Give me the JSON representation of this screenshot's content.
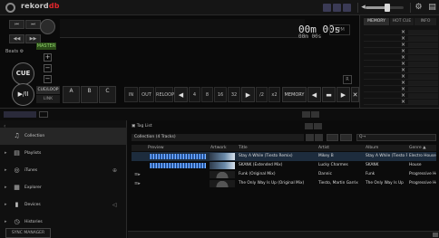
{
  "title_bar": {
    "app_name_prefix": "rekord",
    "app_name_suffix": "db",
    "settings_icon": "gear-icon"
  },
  "deck": {
    "time_display": "00m 00s",
    "time_display_sub": "00m 00s",
    "bpm_label": "BPM",
    "green_tag": "MASTER",
    "cue_label": "CUE",
    "play_label": "▶/II",
    "cue_loop_label": "CUE/LOOP",
    "cue_loop_sub": "LINK",
    "hot_cues": [
      "A",
      "B",
      "C"
    ],
    "loop_controls": [
      "IN",
      "OUT",
      "RELOOP"
    ],
    "loop_sizes": [
      "4",
      "8",
      "16",
      "32"
    ],
    "half_label": "/2",
    "double_label": "x2",
    "memory_label": "MEMORY"
  },
  "memory_panel": {
    "tabs": [
      "MEMORY",
      "HOT CUE",
      "INFO"
    ],
    "rows": [
      "×",
      "×",
      "×",
      "×",
      "×",
      "×",
      "×",
      "×",
      "×",
      "×",
      "×",
      "×"
    ]
  },
  "browser": {
    "tag_list_label": "Tag List",
    "collection_title": "Collection (4 Tracks)",
    "search_placeholder": "Q→",
    "columns": [
      "Preview",
      "Artwork",
      "Title",
      "Artist",
      "Album",
      "Genre"
    ],
    "tracks": [
      {
        "title": "Stay A While (Tiesto Remix)",
        "artist": "Mikey B",
        "album": "Stay A While (Tiesto Re",
        "genre": "Electro House"
      },
      {
        "title": "SKANK (Extended Mix)",
        "artist": "Lucky Charmes",
        "album": "SKANK",
        "genre": "House"
      },
      {
        "title": "Funk (Original Mix)",
        "artist": "Dannic",
        "album": "Funk",
        "genre": "Progressive Hou"
      },
      {
        "title": "The Only Way Is Up (Original Mix)",
        "artist": "Tiesto, Martin Garrix",
        "album": "The Only Way Is Up",
        "genre": "Progressive Hou"
      }
    ]
  },
  "tree": {
    "items": [
      {
        "label": "Collection",
        "icon": "collection-icon"
      },
      {
        "label": "Playlists",
        "icon": "playlist-icon"
      },
      {
        "label": "iTunes",
        "icon": "itunes-icon"
      },
      {
        "label": "Explorer",
        "icon": "explorer-icon"
      },
      {
        "label": "Devices",
        "icon": "devices-icon"
      },
      {
        "label": "Histories",
        "icon": "history-icon"
      }
    ],
    "sync_label": "SYNC MANAGER"
  }
}
